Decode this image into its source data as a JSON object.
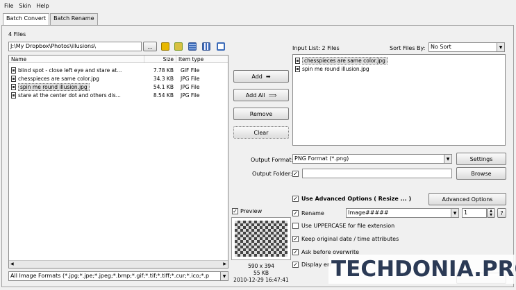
{
  "menu": [
    "File",
    "Skin",
    "Help"
  ],
  "tabs": [
    {
      "label": "Batch Convert",
      "active": true
    },
    {
      "label": "Batch Rename",
      "active": false
    }
  ],
  "file_count": "4 Files",
  "path": "J:\\My Dropbox\\Photos\\illusions\\",
  "browse_small_label": "...",
  "columns": {
    "name": "Name",
    "size": "Size",
    "type": "Item type"
  },
  "files": [
    {
      "name": "blind spot - close left eye and stare at...",
      "size": "7.78 KB",
      "type": "GIF File",
      "selected": false
    },
    {
      "name": "chesspieces are same color.jpg",
      "size": "34.3 KB",
      "type": "JPG File",
      "selected": false
    },
    {
      "name": "spin me round illusion.jpg",
      "size": "54.1 KB",
      "type": "JPG File",
      "selected": true
    },
    {
      "name": "stare at the center dot and others dis...",
      "size": "8.54 KB",
      "type": "JPG File",
      "selected": false
    }
  ],
  "filter": "All Image Formats (*.jpg;*.jpe;*.jpeg;*.bmp;*.gif;*.tif;*.tiff;*.cur;*.ico;*.p",
  "actions": {
    "add": "Add",
    "add_all": "Add All",
    "remove": "Remove",
    "clear": "Clear"
  },
  "input_list": {
    "label": "Input List: 2 Files",
    "sort_label": "Sort Files By:",
    "sort_value": "No Sort",
    "items": [
      "chesspieces are same color.jpg",
      "spin me round illusion.jpg"
    ]
  },
  "output": {
    "format_label": "Output Format:",
    "format_value": "PNG Format (*.png)",
    "settings_label": "Settings",
    "folder_label": "Output Folder:",
    "folder_value": "",
    "browse_label": "Browse"
  },
  "preview": {
    "label": "Preview",
    "dims": "590 x 394",
    "size": "55 KB",
    "date": "2010-12-29 16:47:41"
  },
  "advanced": {
    "use_label": "Use Advanced Options ( Resize ... )",
    "button_label": "Advanced Options",
    "rename_label": "Rename",
    "rename_pattern": "Image#####",
    "rename_start": "1",
    "help_label": "?",
    "uppercase_label": "Use UPPERCASE for file extension",
    "keep_date_label": "Keep original date / time attributes",
    "ask_label": "Ask before overwrite",
    "display_label": "Display err"
  },
  "watermark": "TECHDONIA.PRO",
  "colors": {
    "accent": "#2b3a55",
    "window": "#f0f0f0"
  }
}
